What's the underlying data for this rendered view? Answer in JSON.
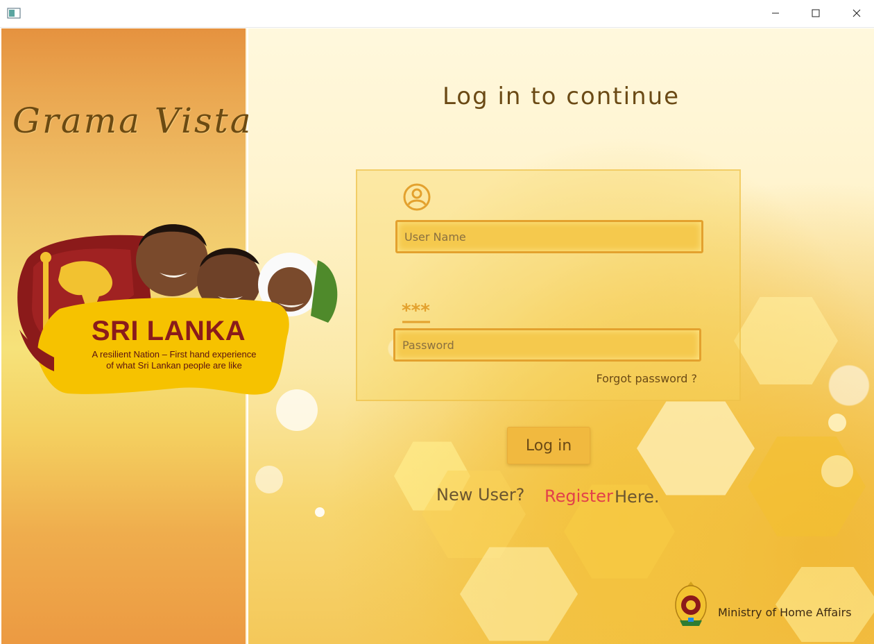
{
  "window": {
    "icon": "app-window-icon",
    "controls": {
      "minimize": "minimize-icon",
      "maximize": "maximize-icon",
      "close": "close-icon"
    }
  },
  "sidebar": {
    "brand": "Grama Vista",
    "banner": {
      "title": "SRI LANKA",
      "subtitle_line1": "A resilient Nation – First hand experience",
      "subtitle_line2": "of what Sri Lankan people are like"
    }
  },
  "login": {
    "heading": "Log in to continue",
    "username": {
      "icon": "user-icon",
      "placeholder": "User Name",
      "value": ""
    },
    "password": {
      "icon": "password-icon",
      "placeholder": "Password",
      "value": ""
    },
    "forgot_password": "Forgot password ?",
    "login_button": "Log in",
    "new_user": "New User?",
    "register": "Register",
    "here": "Here."
  },
  "footer": {
    "emblem": "sri-lanka-emblem",
    "ministry": "Ministry of Home Affairs"
  },
  "colors": {
    "accent": "#f1b93f",
    "register_link": "#e2404a",
    "heading_text": "#6b4a15"
  }
}
